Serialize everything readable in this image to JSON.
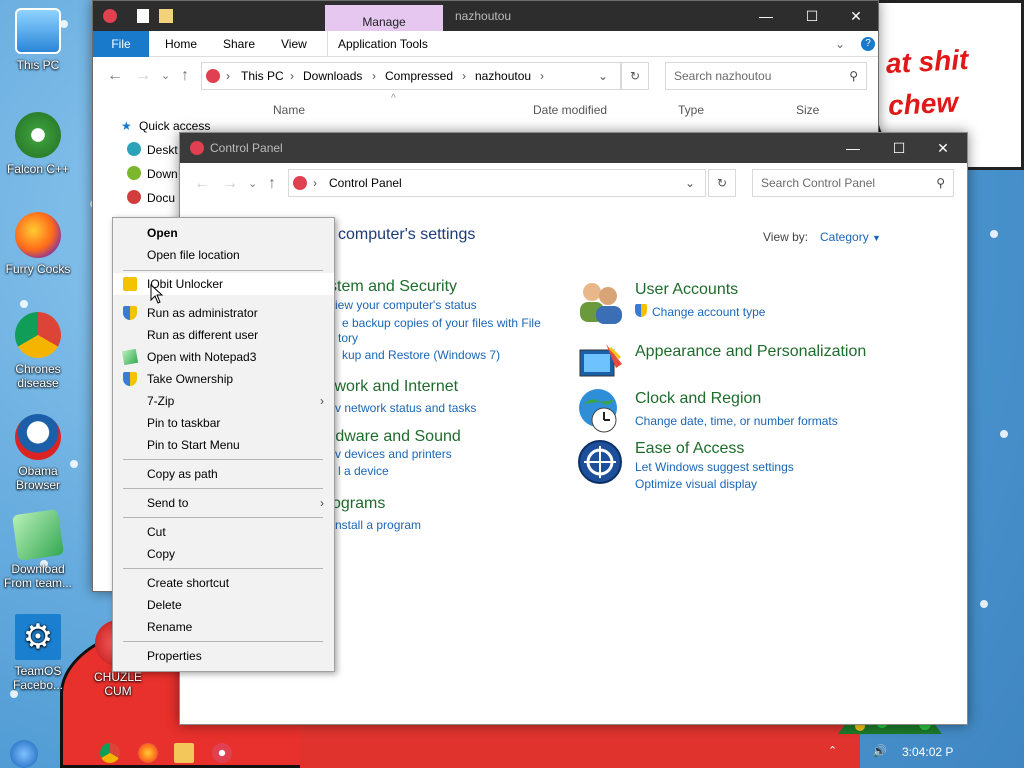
{
  "desktop": {
    "icons": [
      {
        "label": "This PC"
      },
      {
        "label": "Falcon C++"
      },
      {
        "label": "Furry Cocks"
      },
      {
        "label": "Chrones disease"
      },
      {
        "label": "Obama Browser"
      },
      {
        "label": "Download From team..."
      },
      {
        "label": "TeamOS Facebo..."
      },
      {
        "label": "CHUZLE CUM"
      }
    ],
    "bubble_text": "at shit\nchew",
    "clock": "3:04:02 P",
    "colors": {
      "desktop": "#5aa6de",
      "accent": "#1a66b8",
      "category": "#1e6c2b"
    }
  },
  "explorer": {
    "title": "nazhoutou",
    "context_tab": "Manage",
    "ribbon_tabs": [
      "File",
      "Home",
      "Share",
      "View",
      "Application Tools"
    ],
    "breadcrumb": [
      "This PC",
      "Downloads",
      "Compressed",
      "nazhoutou"
    ],
    "search_placeholder": "Search nazhoutou",
    "columns": [
      "Name",
      "Date modified",
      "Type",
      "Size"
    ],
    "nav": {
      "quick_access": "Quick access",
      "items": [
        "Deskt",
        "Down",
        "Docu"
      ]
    }
  },
  "control_panel": {
    "title": "Control Panel",
    "breadcrumb": "Control Panel",
    "search_placeholder": "Search Control Panel",
    "heading": "computer's settings",
    "view_by_label": "View by:",
    "view_by_value": "Category",
    "left_categories": [
      {
        "name": "stem and Security",
        "links": [
          "iew your computer's status",
          "e backup copies of your files with File",
          "tory",
          "kup and Restore (Windows 7)"
        ]
      },
      {
        "name": "twork and Internet",
        "links": [
          "v network status and tasks"
        ]
      },
      {
        "name": "rdware and Sound",
        "links": [
          "v devices and printers",
          "l a device"
        ]
      },
      {
        "name": "ograms",
        "links": [
          "nstall a program"
        ]
      }
    ],
    "right_categories": [
      {
        "name": "User Accounts",
        "links": [
          "Change account type"
        ]
      },
      {
        "name": "Appearance and Personalization",
        "links": []
      },
      {
        "name": "Clock and Region",
        "links": [
          "Change date, time, or number formats"
        ]
      },
      {
        "name": "Ease of Access",
        "links": [
          "Let Windows suggest settings",
          "Optimize visual display"
        ]
      }
    ]
  },
  "context_menu": {
    "items": [
      {
        "label": "Open",
        "bold": true
      },
      {
        "label": "Open file location"
      },
      {
        "label": "IObit Unlocker",
        "icon": "lock-icon"
      },
      {
        "label": "Run as administrator",
        "icon": "shield-icon"
      },
      {
        "label": "Run as different user"
      },
      {
        "label": "Open with Notepad3",
        "icon": "notepad-icon"
      },
      {
        "label": "Take Ownership",
        "icon": "shield-icon"
      },
      {
        "label": "7-Zip",
        "submenu": true
      },
      {
        "label": "Pin to taskbar"
      },
      {
        "label": "Pin to Start Menu"
      },
      {
        "label": "Copy as path"
      },
      {
        "label": "Send to",
        "submenu": true
      },
      {
        "label": "Cut"
      },
      {
        "label": "Copy"
      },
      {
        "label": "Create shortcut"
      },
      {
        "label": "Delete"
      },
      {
        "label": "Rename"
      },
      {
        "label": "Properties"
      }
    ]
  }
}
